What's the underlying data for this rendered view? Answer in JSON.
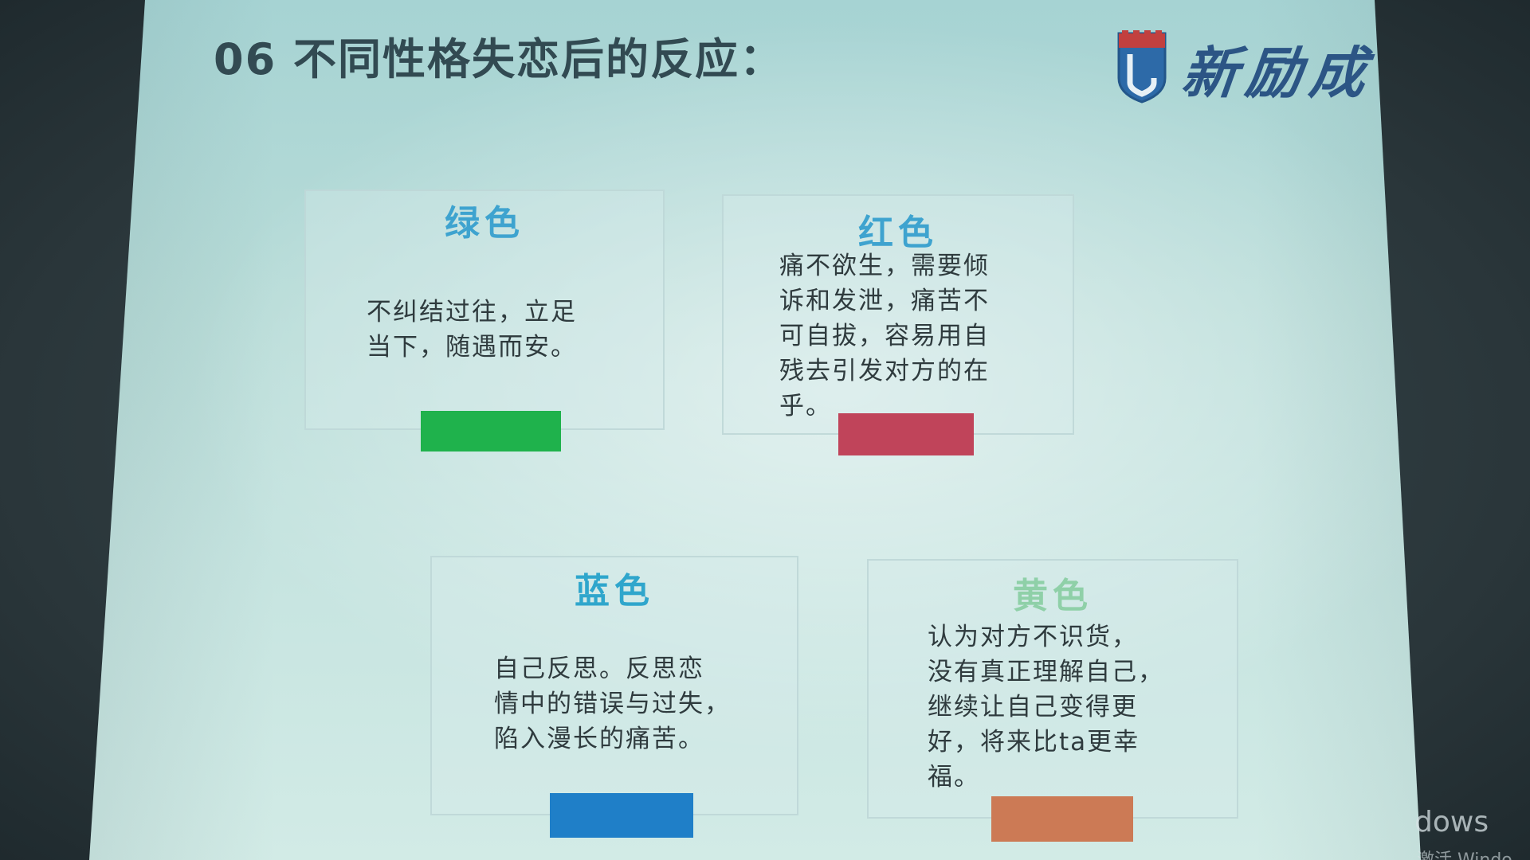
{
  "slide": {
    "title": "06 不同性格失恋后的反应：",
    "logo_text": "新励成"
  },
  "cards": [
    {
      "title": "绿色",
      "body": "不纠结过往，立足\n当下，随遇而安。",
      "title_color": "#3ea3cf",
      "swatch_color": "#1fb24c"
    },
    {
      "title": "红色",
      "body": "痛不欲生，需要倾\n诉和发泄，痛苦不\n可自拔，容易用自\n残去引发对方的在\n乎。",
      "title_color": "#3ea3cf",
      "swatch_color": "#c0445a"
    },
    {
      "title": "蓝色",
      "body": "自己反思。反思恋\n情中的错误与过失，\n陷入漫长的痛苦。",
      "title_color": "#2fa6cc",
      "swatch_color": "#1f7fc8"
    },
    {
      "title": "黄色",
      "body": "认为对方不识货，\n没有真正理解自己，\n继续让自己变得更\n好，将来比ta更幸\n福。",
      "title_color": "#8fd0a8",
      "swatch_color": "#cc7a55"
    }
  ],
  "watermark": {
    "line1": "dows",
    "line2": "激活 Windo"
  }
}
